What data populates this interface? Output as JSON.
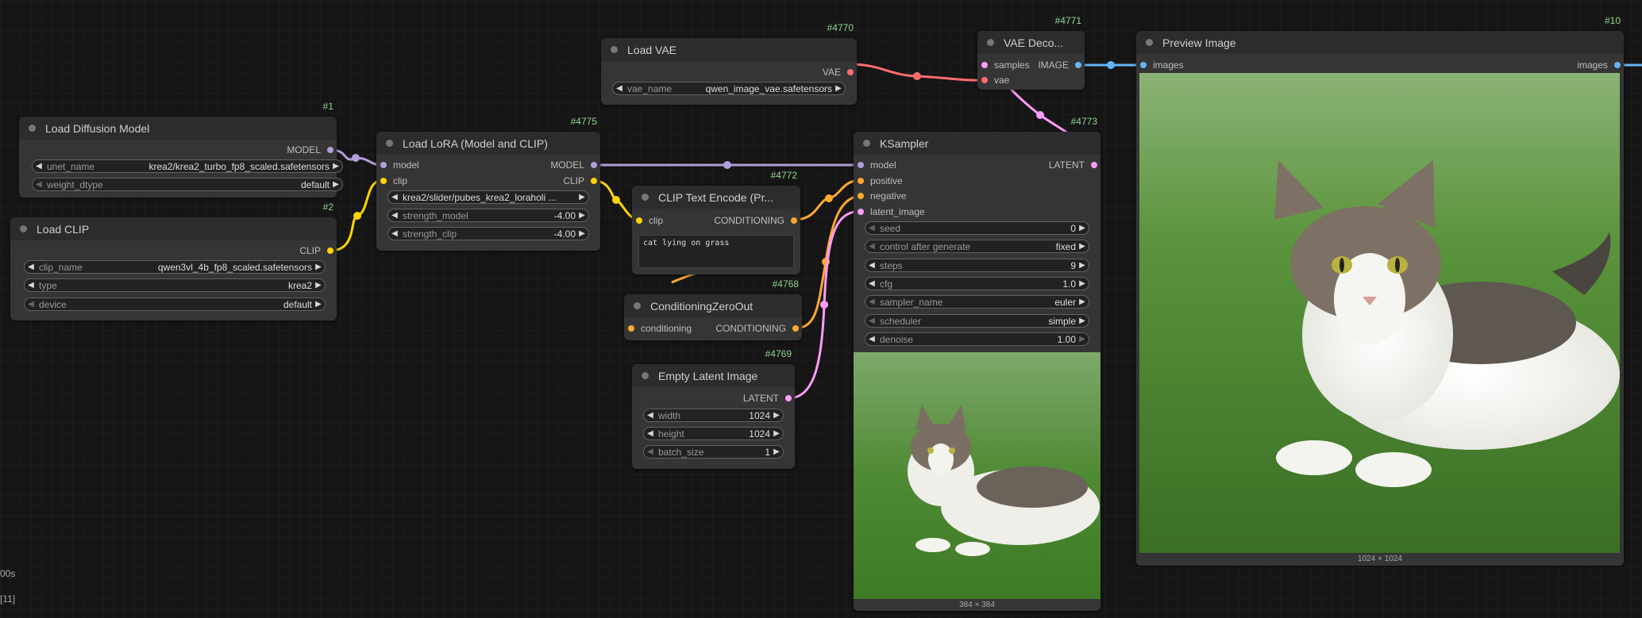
{
  "side": {
    "time": "00s",
    "queue": "[11]"
  },
  "nodes": {
    "load_diffusion": {
      "id": "#1",
      "title": "Load Diffusion Model",
      "output": "MODEL",
      "unet_name_label": "unet_name",
      "unet_name": "krea2/krea2_turbo_fp8_scaled.safetensors",
      "weight_dtype_label": "weight_dtype",
      "weight_dtype": "default"
    },
    "load_clip": {
      "id": "#2",
      "title": "Load CLIP",
      "output": "CLIP",
      "clip_name_label": "clip_name",
      "clip_name": "qwen3vl_4b_fp8_scaled.safetensors",
      "type_label": "type",
      "type": "krea2",
      "device_label": "device",
      "device": "default"
    },
    "load_lora": {
      "id": "#4775",
      "title": "Load LoRA (Model and CLIP)",
      "in_model": "model",
      "in_clip": "clip",
      "out_model": "MODEL",
      "out_clip": "CLIP",
      "lora_name": "krea2/slider/pubes_krea2_loraholi ...",
      "strength_model_label": "strength_model",
      "strength_model": "-4.00",
      "strength_clip_label": "strength_clip",
      "strength_clip": "-4.00"
    },
    "load_vae": {
      "id": "#4770",
      "title": "Load VAE",
      "output": "VAE",
      "vae_name_label": "vae_name",
      "vae_name": "qwen_image_vae.safetensors"
    },
    "clip_text": {
      "id": "#4772",
      "title": "CLIP Text Encode (Pr...",
      "in_clip": "clip",
      "output": "CONDITIONING",
      "text": "cat lying on grass"
    },
    "cond_zero": {
      "id": "#4768",
      "title": "ConditioningZeroOut",
      "in_cond": "conditioning",
      "output": "CONDITIONING"
    },
    "empty_latent": {
      "id": "#4769",
      "title": "Empty Latent Image",
      "output": "LATENT",
      "width_label": "width",
      "width": "1024",
      "height_label": "height",
      "height": "1024",
      "batch_label": "batch_size",
      "batch": "1"
    },
    "vae_decode": {
      "id": "#4771",
      "title": "VAE Deco...",
      "in_samples": "samples",
      "in_vae": "vae",
      "output": "IMAGE"
    },
    "ksampler": {
      "id": "#4773",
      "title": "KSampler",
      "in_model": "model",
      "in_positive": "positive",
      "in_negative": "negative",
      "in_latent": "latent_image",
      "output": "LATENT",
      "seed_label": "seed",
      "seed": "0",
      "control_label": "control after generate",
      "control": "fixed",
      "steps_label": "steps",
      "steps": "9",
      "cfg_label": "cfg",
      "cfg": "1.0",
      "sampler_label": "sampler_name",
      "sampler": "euler",
      "scheduler_label": "scheduler",
      "scheduler": "simple",
      "denoise_label": "denoise",
      "denoise": "1.00",
      "preview_size": "384 × 384"
    },
    "preview": {
      "id": "#10",
      "title": "Preview Image",
      "in_images": "images",
      "out_images": "images",
      "preview_size": "1024 × 1024"
    }
  },
  "colors": {
    "model": "#b39ddb",
    "clip": "#ffd500",
    "vae": "#ff6e6e",
    "conditioning": "#ffa931",
    "latent": "#ff9cf9",
    "image": "#64b5f6"
  }
}
